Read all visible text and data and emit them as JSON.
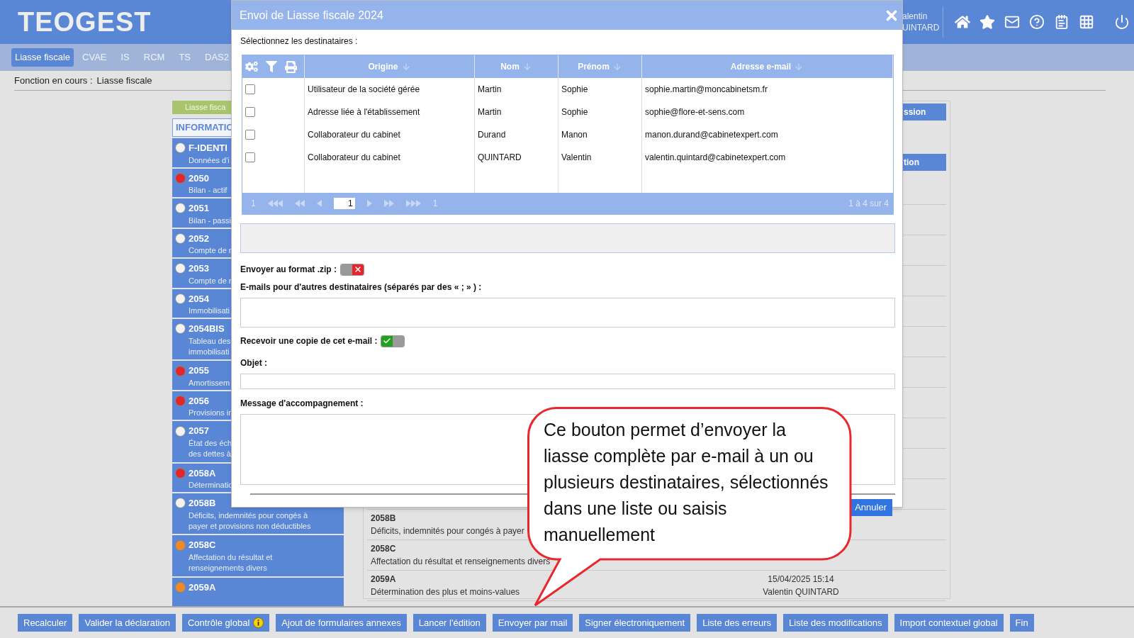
{
  "header": {
    "logo": "TEOGEST",
    "user_lines": [
      "alentin",
      "UINTARD"
    ]
  },
  "tabs": [
    {
      "label": "Liasse fiscale",
      "selected": true
    },
    {
      "label": "CVAE",
      "selected": false
    },
    {
      "label": "IS",
      "selected": false
    },
    {
      "label": "RCM",
      "selected": false
    },
    {
      "label": "TS",
      "selected": false
    },
    {
      "label": "DAS2",
      "selected": false
    }
  ],
  "breadcrumb": {
    "label": "Fonction en cours :",
    "value": "Liasse fiscale"
  },
  "sidebar": {
    "title": "Liasse fisca",
    "section": "INFORMATIC",
    "items": [
      {
        "code": "F-IDENTI",
        "description": [
          "Données d'i"
        ],
        "color": "#f2f2f2"
      },
      {
        "code": "2050",
        "description": [
          "Bilan - actif"
        ],
        "color": "#e0282a"
      },
      {
        "code": "2051",
        "description": [
          "Bilan - passi"
        ],
        "color": "#f2f2f2"
      },
      {
        "code": "2052",
        "description": [
          "Compte de r"
        ],
        "color": "#f2f2f2"
      },
      {
        "code": "2053",
        "description": [
          "Compte de r"
        ],
        "color": "#f2f2f2"
      },
      {
        "code": "2054",
        "description": [
          "Immobilisati"
        ],
        "color": "#f2f2f2"
      },
      {
        "code": "2054BIS",
        "description": [
          "Tableau des",
          "immobilisati"
        ],
        "color": "#f2f2f2"
      },
      {
        "code": "2055",
        "description": [
          "Amortissem"
        ],
        "color": "#e0282a"
      },
      {
        "code": "2056",
        "description": [
          "Provisions ir"
        ],
        "color": "#e0282a"
      },
      {
        "code": "2057",
        "description": [
          "État des éch",
          "des dettes à"
        ],
        "color": "#f2f2f2"
      },
      {
        "code": "2058A",
        "description": [
          "Déterminatic"
        ],
        "color": "#e0282a"
      },
      {
        "code": "2058B",
        "description": [
          "Déficits, indemnités pour congés à",
          "payer et provisions non déductibles"
        ],
        "color": "#f2f2f2"
      },
      {
        "code": "2058C",
        "description": [
          "Affectation du résultat et",
          "renseignements divers"
        ],
        "color": "#f08a24"
      },
      {
        "code": "2059A",
        "color": "#f08a24"
      }
    ]
  },
  "panel": {
    "buttons": [
      "ssion",
      "tion"
    ],
    "rows": [
      {
        "code": "2058B",
        "description": "Déficits, indemnités pour congés à payer"
      },
      {
        "code": "2058C",
        "description": "Affectation du résultat et renseignements divers"
      },
      {
        "code": "2059A",
        "description": "Détermination des plus et moins-values",
        "date": "15/04/2025 15:14",
        "user": "Valentin QUINTARD"
      }
    ]
  },
  "toolbar": [
    {
      "label": "Recalculer",
      "info": false
    },
    {
      "label": "Valider la déclaration",
      "info": false
    },
    {
      "label": "Contrôle global",
      "info": true
    },
    {
      "label": "Ajout de formulaires annexes",
      "info": false
    },
    {
      "label": "Lancer l'édition",
      "info": false
    },
    {
      "label": "Envoyer par mail",
      "info": false
    },
    {
      "label": "Signer électroniquement",
      "info": false
    },
    {
      "label": "Liste des erreurs",
      "info": false
    },
    {
      "label": "Liste des modifications",
      "info": false
    },
    {
      "label": "Import contextuel global",
      "info": false
    },
    {
      "label": "Fin",
      "info": false
    }
  ],
  "dialog": {
    "title": "Envoi de Liasse fiscale 2024",
    "recipients_label": "Sélectionnez les destinataires :",
    "table": {
      "columns": [
        "Origine",
        "Nom",
        "Prénom",
        "Adresse e-mail"
      ],
      "rows": [
        {
          "checked": false,
          "cells": [
            "Utilisateur de la société gérée",
            "Martin",
            "Sophie",
            "sophie.martin@moncabinetsm.fr"
          ]
        },
        {
          "checked": false,
          "cells": [
            "Adresse liée à l'établissement",
            "Martin",
            "Sophie",
            "sophie@flore-et-sens.com"
          ]
        },
        {
          "checked": false,
          "cells": [
            "Collaborateur du cabinet",
            "Durand",
            "Manon",
            "manon.durand@cabinetexpert.com"
          ]
        },
        {
          "checked": false,
          "cells": [
            "Collaborateur du cabinet",
            "QUINTARD",
            "Valentin",
            "valentin.quintard@cabinetexpert.com"
          ]
        }
      ],
      "pager": {
        "first": "1",
        "current": "1",
        "last": "1",
        "summary": "1 à 4 sur 4"
      }
    },
    "zip": {
      "label": "Envoyer au format .zip :",
      "on": false
    },
    "other_emails_label": "E-mails pour d'autres destinataires (séparés par des « ; » ) :",
    "copy": {
      "label": "Recevoir une copie de cet e-mail :",
      "on": true
    },
    "subject_label": "Objet :",
    "message_label": "Message d'accompagnement :",
    "cancel": "Annuler"
  },
  "callout": {
    "text_lines": [
      "Ce bouton permet d’envoyer la",
      "liasse complète par e-mail à un ou",
      "plusieurs destinataires, sélectionnés",
      "dans une liste ou saisis",
      "manuellement"
    ]
  }
}
